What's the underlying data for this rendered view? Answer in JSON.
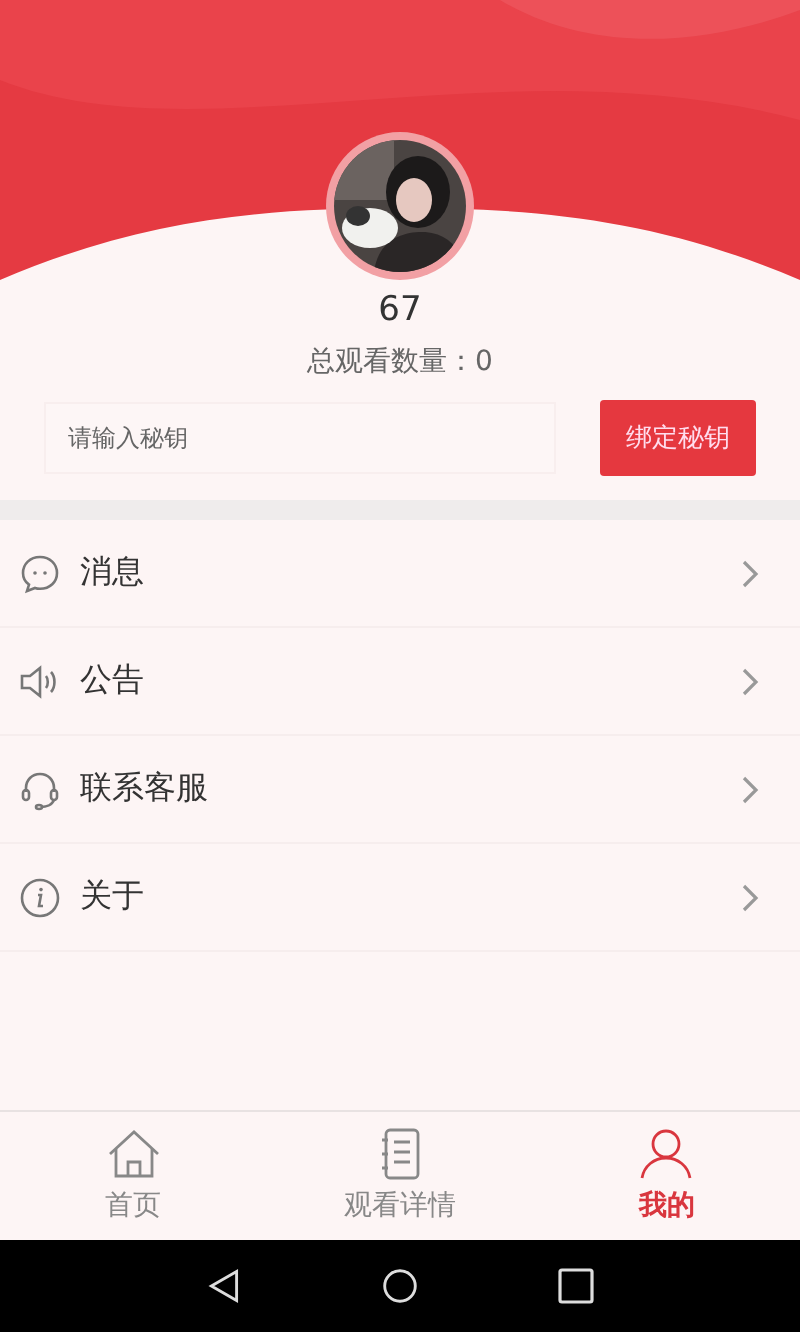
{
  "profile": {
    "name": "67",
    "stat": "总观看数量：0"
  },
  "key_form": {
    "placeholder": "请输入秘钥",
    "button": "绑定秘钥"
  },
  "menu": [
    {
      "label": "消息"
    },
    {
      "label": "公告"
    },
    {
      "label": "联系客服"
    },
    {
      "label": "关于"
    }
  ],
  "tabs": [
    {
      "label": "首页",
      "selected": false
    },
    {
      "label": "观看详情",
      "selected": false
    },
    {
      "label": "我的",
      "selected": true
    }
  ]
}
